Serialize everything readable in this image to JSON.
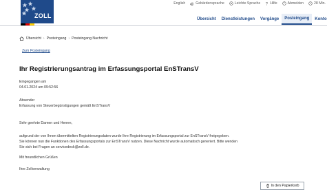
{
  "header": {
    "logo_text": "ZOLL",
    "flag_colors": [
      "#000000",
      "#dd0000",
      "#ffce00"
    ],
    "brand_color": "#1f4a8a",
    "util_nav": [
      {
        "label": "English",
        "icon": null
      },
      {
        "label": "Gebärdensprache",
        "icon": "hand-icon"
      },
      {
        "label": "Leichte Sprache",
        "icon": "easy-language-icon"
      },
      {
        "label": "Hilfe",
        "icon": "help-icon"
      },
      {
        "label": "Abmelden",
        "icon": "logout-icon"
      },
      {
        "label": "28 Min.",
        "icon": "clock-icon"
      }
    ],
    "main_nav": [
      {
        "label": "Übersicht",
        "active": false
      },
      {
        "label": "Dienstleistungen",
        "active": false
      },
      {
        "label": "Vorgänge",
        "active": false
      },
      {
        "label": "Posteingang",
        "active": true
      },
      {
        "label": "Konto",
        "active": false
      }
    ]
  },
  "breadcrumb": {
    "items": [
      "Übersicht",
      "Posteingang",
      "Posteingang Nachricht"
    ]
  },
  "back_link": "Zum Posteingang",
  "message": {
    "title": "Ihr Registrierungsantrag im Erfassungsportal EnSTransV",
    "received_label": "Eingegangen am",
    "received_value": "04.01.2024 um 09:52:56",
    "sender_label": "Absender",
    "sender_value": "Erfassung von Steuerbegünstigungen gemäß EnSTransV",
    "greeting": "Sehr geehrte Damen und Herren,",
    "body_lines": [
      "aufgrund der von Ihnen übermittelten Registrierungsdaten wurde Ihre Registrierung im Erfassungsportal zur EnSTransV freigegeben.",
      "Sie können nun die Funktionen des Erfassungsportals zur EnSTransV nutzen. Diese Nachricht wurde automatisch generiert. Bitte wenden",
      "Sie sich bei Fragen an servicedesk@zoll.de."
    ],
    "closing": "Mit freundlichen Grüßen",
    "signature": "Ihre Zollverwaltung"
  },
  "actions": {
    "trash_label": "In den Papierkorb"
  }
}
